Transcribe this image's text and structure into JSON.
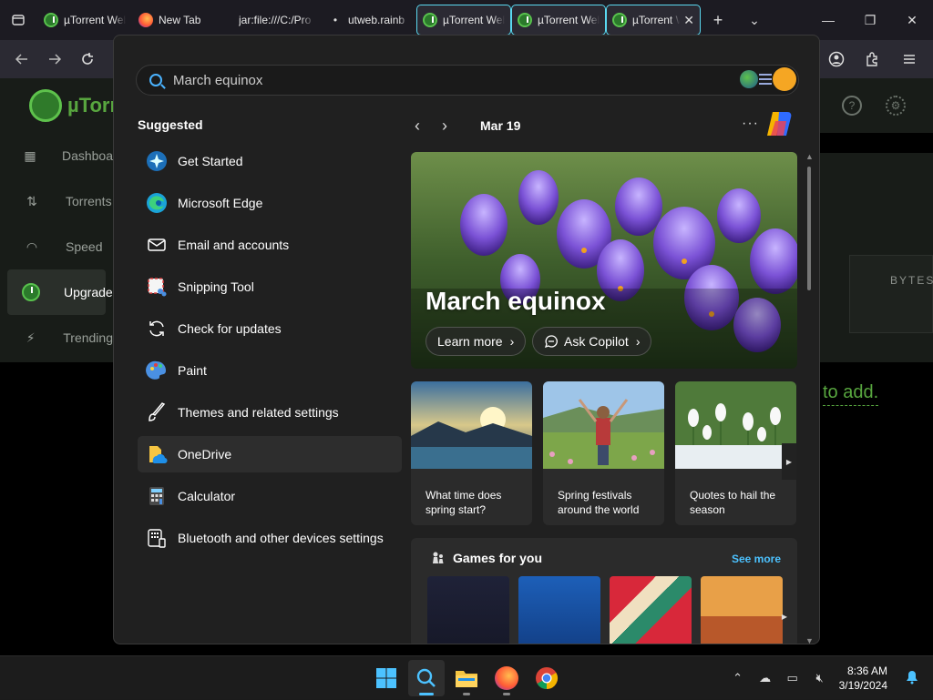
{
  "browser": {
    "tabs": [
      {
        "title": "µTorrent Web",
        "favicon": "utorrent-icon",
        "active": false
      },
      {
        "title": "New Tab",
        "favicon": "firefox-icon",
        "active": false
      },
      {
        "title": "jar:file:///C:/Pro",
        "favicon": "none",
        "active": false
      },
      {
        "title": "utweb.rainb",
        "favicon": "dot-icon",
        "active": false
      },
      {
        "title": "µTorrent Web",
        "favicon": "utorrent-icon",
        "active": true
      },
      {
        "title": "µTorrent Web",
        "favicon": "utorrent-icon",
        "active": true
      },
      {
        "title": "µTorrent Web",
        "favicon": "utorrent-icon",
        "active": true,
        "closable": true
      }
    ],
    "new_tab_symbol": "+",
    "tab_overflow_symbol": "⌄",
    "window_controls": {
      "minimize": "—",
      "maximize": "❐",
      "close": "✕"
    }
  },
  "utorrent": {
    "brand": "µTorre",
    "sidebar": [
      "Dashboa",
      "Torrents",
      "Speed",
      "Upgrade",
      "Trending"
    ],
    "bytes_label": "BYTES",
    "to_add_text": "to add."
  },
  "search": {
    "query": "",
    "placeholder": "March equinox"
  },
  "suggested": {
    "title": "Suggested",
    "items": [
      {
        "label": "Get Started",
        "icon": "get-started-icon"
      },
      {
        "label": "Microsoft Edge",
        "icon": "edge-icon"
      },
      {
        "label": "Email and accounts",
        "icon": "email-icon"
      },
      {
        "label": "Snipping Tool",
        "icon": "snipping-tool-icon"
      },
      {
        "label": "Check for updates",
        "icon": "update-icon"
      },
      {
        "label": "Paint",
        "icon": "paint-icon"
      },
      {
        "label": "Themes and related settings",
        "icon": "brush-icon"
      },
      {
        "label": "OneDrive",
        "icon": "onedrive-icon",
        "selected": true
      },
      {
        "label": "Calculator",
        "icon": "calculator-icon"
      },
      {
        "label": "Bluetooth and other devices settings",
        "icon": "devices-icon"
      }
    ]
  },
  "highlights": {
    "date": "Mar 19",
    "more": "···",
    "hero": {
      "title": "March equinox",
      "learn_more": "Learn more",
      "ask_copilot": "Ask Copilot"
    },
    "cards": [
      {
        "text": "What time does spring start?"
      },
      {
        "text": "Spring festivals around the world"
      },
      {
        "text": "Quotes to hail the season"
      }
    ],
    "games": {
      "title": "Games for you",
      "see_more": "See more"
    }
  },
  "taskbar": {
    "time": "8:36 AM",
    "date": "3/19/2024"
  },
  "colors": {
    "accent": "#4cc2ff",
    "utorrent_green": "#58a63f",
    "panel_bg": "#202020"
  }
}
